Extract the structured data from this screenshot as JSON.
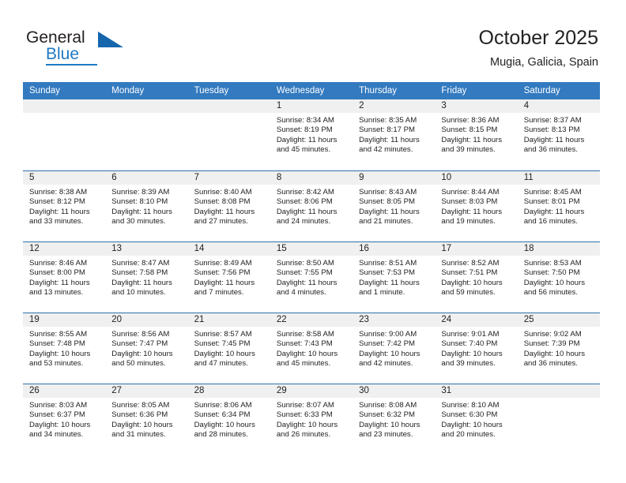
{
  "logo": {
    "word_top": "General",
    "word_bottom": "Blue",
    "accent_color": "#1f7ac4",
    "dark_color": "#231f20"
  },
  "header": {
    "title": "October 2025",
    "subtitle": "Mugia, Galicia, Spain"
  },
  "theme": {
    "header_blue": "#337ac0",
    "row_line_blue": "#2f6fae",
    "daynum_bg": "#f0f0f0"
  },
  "calendar": {
    "day_headers": [
      "Sunday",
      "Monday",
      "Tuesday",
      "Wednesday",
      "Thursday",
      "Friday",
      "Saturday"
    ],
    "weeks": [
      [
        {
          "day": "",
          "sunrise": "",
          "sunset": "",
          "daylight": "",
          "daylight2": "",
          "empty": true
        },
        {
          "day": "",
          "sunrise": "",
          "sunset": "",
          "daylight": "",
          "daylight2": "",
          "empty": true
        },
        {
          "day": "",
          "sunrise": "",
          "sunset": "",
          "daylight": "",
          "daylight2": "",
          "empty": true
        },
        {
          "day": "1",
          "sunrise": "Sunrise: 8:34 AM",
          "sunset": "Sunset: 8:19 PM",
          "daylight": "Daylight: 11 hours",
          "daylight2": "and 45 minutes."
        },
        {
          "day": "2",
          "sunrise": "Sunrise: 8:35 AM",
          "sunset": "Sunset: 8:17 PM",
          "daylight": "Daylight: 11 hours",
          "daylight2": "and 42 minutes."
        },
        {
          "day": "3",
          "sunrise": "Sunrise: 8:36 AM",
          "sunset": "Sunset: 8:15 PM",
          "daylight": "Daylight: 11 hours",
          "daylight2": "and 39 minutes."
        },
        {
          "day": "4",
          "sunrise": "Sunrise: 8:37 AM",
          "sunset": "Sunset: 8:13 PM",
          "daylight": "Daylight: 11 hours",
          "daylight2": "and 36 minutes."
        }
      ],
      [
        {
          "day": "5",
          "sunrise": "Sunrise: 8:38 AM",
          "sunset": "Sunset: 8:12 PM",
          "daylight": "Daylight: 11 hours",
          "daylight2": "and 33 minutes."
        },
        {
          "day": "6",
          "sunrise": "Sunrise: 8:39 AM",
          "sunset": "Sunset: 8:10 PM",
          "daylight": "Daylight: 11 hours",
          "daylight2": "and 30 minutes."
        },
        {
          "day": "7",
          "sunrise": "Sunrise: 8:40 AM",
          "sunset": "Sunset: 8:08 PM",
          "daylight": "Daylight: 11 hours",
          "daylight2": "and 27 minutes."
        },
        {
          "day": "8",
          "sunrise": "Sunrise: 8:42 AM",
          "sunset": "Sunset: 8:06 PM",
          "daylight": "Daylight: 11 hours",
          "daylight2": "and 24 minutes."
        },
        {
          "day": "9",
          "sunrise": "Sunrise: 8:43 AM",
          "sunset": "Sunset: 8:05 PM",
          "daylight": "Daylight: 11 hours",
          "daylight2": "and 21 minutes."
        },
        {
          "day": "10",
          "sunrise": "Sunrise: 8:44 AM",
          "sunset": "Sunset: 8:03 PM",
          "daylight": "Daylight: 11 hours",
          "daylight2": "and 19 minutes."
        },
        {
          "day": "11",
          "sunrise": "Sunrise: 8:45 AM",
          "sunset": "Sunset: 8:01 PM",
          "daylight": "Daylight: 11 hours",
          "daylight2": "and 16 minutes."
        }
      ],
      [
        {
          "day": "12",
          "sunrise": "Sunrise: 8:46 AM",
          "sunset": "Sunset: 8:00 PM",
          "daylight": "Daylight: 11 hours",
          "daylight2": "and 13 minutes."
        },
        {
          "day": "13",
          "sunrise": "Sunrise: 8:47 AM",
          "sunset": "Sunset: 7:58 PM",
          "daylight": "Daylight: 11 hours",
          "daylight2": "and 10 minutes."
        },
        {
          "day": "14",
          "sunrise": "Sunrise: 8:49 AM",
          "sunset": "Sunset: 7:56 PM",
          "daylight": "Daylight: 11 hours",
          "daylight2": "and 7 minutes."
        },
        {
          "day": "15",
          "sunrise": "Sunrise: 8:50 AM",
          "sunset": "Sunset: 7:55 PM",
          "daylight": "Daylight: 11 hours",
          "daylight2": "and 4 minutes."
        },
        {
          "day": "16",
          "sunrise": "Sunrise: 8:51 AM",
          "sunset": "Sunset: 7:53 PM",
          "daylight": "Daylight: 11 hours",
          "daylight2": "and 1 minute."
        },
        {
          "day": "17",
          "sunrise": "Sunrise: 8:52 AM",
          "sunset": "Sunset: 7:51 PM",
          "daylight": "Daylight: 10 hours",
          "daylight2": "and 59 minutes."
        },
        {
          "day": "18",
          "sunrise": "Sunrise: 8:53 AM",
          "sunset": "Sunset: 7:50 PM",
          "daylight": "Daylight: 10 hours",
          "daylight2": "and 56 minutes."
        }
      ],
      [
        {
          "day": "19",
          "sunrise": "Sunrise: 8:55 AM",
          "sunset": "Sunset: 7:48 PM",
          "daylight": "Daylight: 10 hours",
          "daylight2": "and 53 minutes."
        },
        {
          "day": "20",
          "sunrise": "Sunrise: 8:56 AM",
          "sunset": "Sunset: 7:47 PM",
          "daylight": "Daylight: 10 hours",
          "daylight2": "and 50 minutes."
        },
        {
          "day": "21",
          "sunrise": "Sunrise: 8:57 AM",
          "sunset": "Sunset: 7:45 PM",
          "daylight": "Daylight: 10 hours",
          "daylight2": "and 47 minutes."
        },
        {
          "day": "22",
          "sunrise": "Sunrise: 8:58 AM",
          "sunset": "Sunset: 7:43 PM",
          "daylight": "Daylight: 10 hours",
          "daylight2": "and 45 minutes."
        },
        {
          "day": "23",
          "sunrise": "Sunrise: 9:00 AM",
          "sunset": "Sunset: 7:42 PM",
          "daylight": "Daylight: 10 hours",
          "daylight2": "and 42 minutes."
        },
        {
          "day": "24",
          "sunrise": "Sunrise: 9:01 AM",
          "sunset": "Sunset: 7:40 PM",
          "daylight": "Daylight: 10 hours",
          "daylight2": "and 39 minutes."
        },
        {
          "day": "25",
          "sunrise": "Sunrise: 9:02 AM",
          "sunset": "Sunset: 7:39 PM",
          "daylight": "Daylight: 10 hours",
          "daylight2": "and 36 minutes."
        }
      ],
      [
        {
          "day": "26",
          "sunrise": "Sunrise: 8:03 AM",
          "sunset": "Sunset: 6:37 PM",
          "daylight": "Daylight: 10 hours",
          "daylight2": "and 34 minutes."
        },
        {
          "day": "27",
          "sunrise": "Sunrise: 8:05 AM",
          "sunset": "Sunset: 6:36 PM",
          "daylight": "Daylight: 10 hours",
          "daylight2": "and 31 minutes."
        },
        {
          "day": "28",
          "sunrise": "Sunrise: 8:06 AM",
          "sunset": "Sunset: 6:34 PM",
          "daylight": "Daylight: 10 hours",
          "daylight2": "and 28 minutes."
        },
        {
          "day": "29",
          "sunrise": "Sunrise: 8:07 AM",
          "sunset": "Sunset: 6:33 PM",
          "daylight": "Daylight: 10 hours",
          "daylight2": "and 26 minutes."
        },
        {
          "day": "30",
          "sunrise": "Sunrise: 8:08 AM",
          "sunset": "Sunset: 6:32 PM",
          "daylight": "Daylight: 10 hours",
          "daylight2": "and 23 minutes."
        },
        {
          "day": "31",
          "sunrise": "Sunrise: 8:10 AM",
          "sunset": "Sunset: 6:30 PM",
          "daylight": "Daylight: 10 hours",
          "daylight2": "and 20 minutes."
        },
        {
          "day": "",
          "sunrise": "",
          "sunset": "",
          "daylight": "",
          "daylight2": "",
          "empty": true
        }
      ]
    ]
  }
}
